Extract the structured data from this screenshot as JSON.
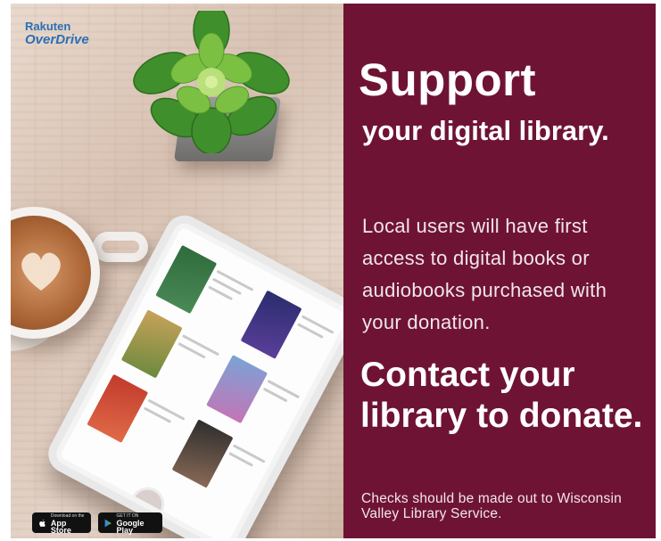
{
  "logo": {
    "line1": "Rakuten",
    "line2": "OverDrive",
    "color": "#2a6fb5"
  },
  "panel": {
    "background": "#6f1334",
    "headline": "Support",
    "subheadline": "your digital library.",
    "body": "Local users will have first access to digital books or audiobooks purchased with your donation.",
    "cta": "Contact your library to donate.",
    "footnote": "Checks should be made out to Wisconsin Valley Library Service."
  },
  "badges": {
    "app_store": {
      "small": "Download on the",
      "big": "App Store",
      "icon": "apple-icon"
    },
    "google_play": {
      "small": "GET IT ON",
      "big": "Google Play",
      "icon": "play-triangle-icon"
    }
  }
}
